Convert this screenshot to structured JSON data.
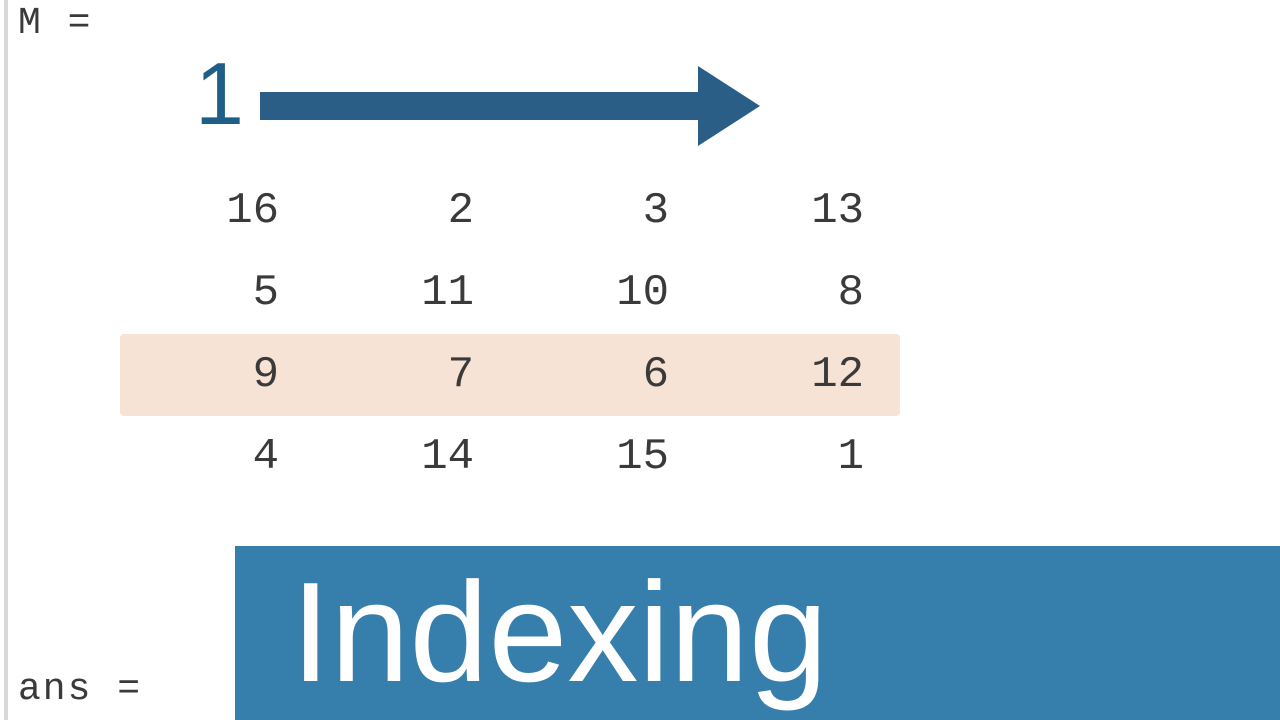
{
  "variable_M_label": "M =",
  "index_label": "1",
  "matrix": {
    "rows": [
      {
        "cells": [
          "16",
          "2",
          "3",
          "13"
        ],
        "highlight": false
      },
      {
        "cells": [
          "5",
          "11",
          "10",
          "8"
        ],
        "highlight": false
      },
      {
        "cells": [
          "9",
          "7",
          "6",
          "12"
        ],
        "highlight": true
      },
      {
        "cells": [
          "4",
          "14",
          "15",
          "1"
        ],
        "highlight": false
      }
    ]
  },
  "banner_title": "Indexing",
  "variable_ans_label": "ans ="
}
